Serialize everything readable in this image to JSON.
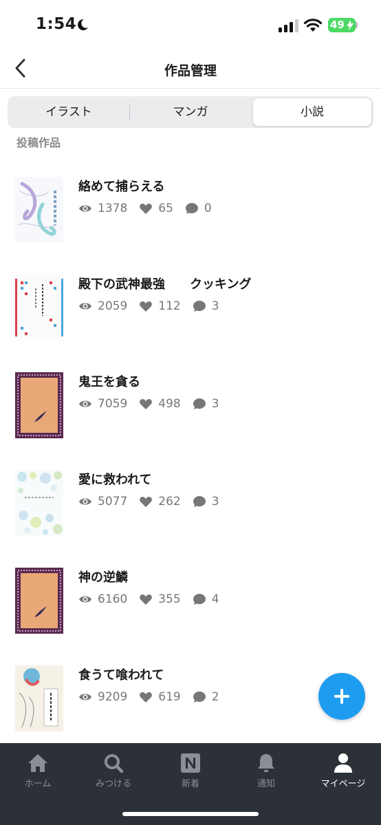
{
  "status_bar": {
    "time": "1:54",
    "battery": "49",
    "colors": {
      "battery": "#4cd964"
    }
  },
  "header": {
    "title": "作品管理",
    "back_icon": "chevron-left-icon"
  },
  "segments": [
    {
      "label": "イラスト",
      "selected": false
    },
    {
      "label": "マンガ",
      "selected": false
    },
    {
      "label": "小説",
      "selected": true
    }
  ],
  "section_label": "投稿作品",
  "works": [
    {
      "title": "絡めて捕らえる",
      "views": "1378",
      "likes": "65",
      "comments": "0",
      "cover_icon": "fish-cover-icon"
    },
    {
      "title": "殿下の武神最強　　クッキング",
      "views": "2059",
      "likes": "112",
      "comments": "3",
      "cover_icon": "patterned-cover-icon"
    },
    {
      "title": "鬼王を貪る",
      "views": "7059",
      "likes": "498",
      "comments": "3",
      "cover_icon": "framed-cover-icon"
    },
    {
      "title": "愛に救われて",
      "views": "5077",
      "likes": "262",
      "comments": "3",
      "cover_icon": "bubbles-cover-icon"
    },
    {
      "title": "神の逆鱗",
      "views": "6160",
      "likes": "355",
      "comments": "4",
      "cover_icon": "framed-cover-icon"
    },
    {
      "title": "食うて喰われて",
      "views": "9209",
      "likes": "619",
      "comments": "2",
      "cover_icon": "flower-cover-icon"
    }
  ],
  "fab_icon": "plus-icon",
  "tabs": [
    {
      "label": "ホーム",
      "icon": "home-icon",
      "active": false
    },
    {
      "label": "みつける",
      "icon": "search-icon",
      "active": false
    },
    {
      "label": "新着",
      "icon": "new-icon",
      "active": false
    },
    {
      "label": "通知",
      "icon": "bell-icon",
      "active": false
    },
    {
      "label": "マイページ",
      "icon": "person-icon",
      "active": true
    }
  ],
  "colors": {
    "accent": "#1e9cf0",
    "tab_bar": "#2c3137",
    "stat_gray": "#777777"
  }
}
